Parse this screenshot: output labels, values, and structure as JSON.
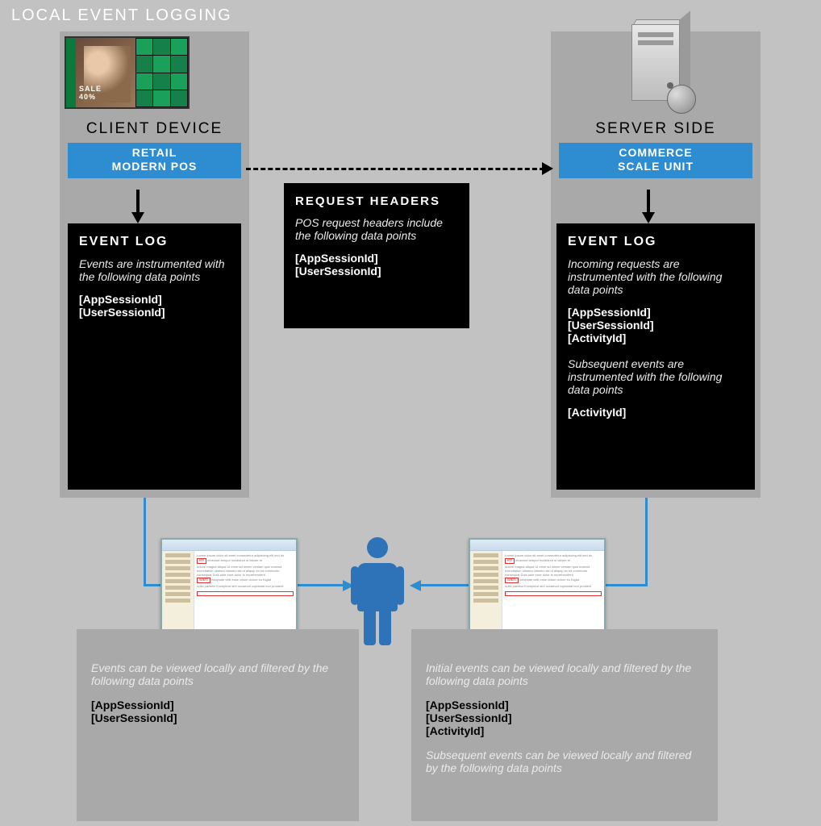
{
  "title": "LOCAL EVENT  LOGGING",
  "client": {
    "panel_title": "CLIENT DEVICE",
    "band_line1": "RETAIL",
    "band_line2": "MODERN POS",
    "tablet_sale_label": "SALE",
    "tablet_sale_sub": "40%",
    "eventlog_title": "EVENT LOG",
    "eventlog_desc": "Events are instrumented with the following data points",
    "eventlog_points": "[AppSessionId]\n[UserSessionId]"
  },
  "server": {
    "panel_title": "SERVER SIDE",
    "band_line1": "COMMERCE",
    "band_line2": "SCALE UNIT",
    "eventlog_title": "EVENT LOG",
    "eventlog_desc1": "Incoming requests are instrumented with the following data points",
    "eventlog_points1": "[AppSessionId]\n[UserSessionId]\n[ActivityId]",
    "eventlog_desc2": "Subsequent events are instrumented with the following data points",
    "eventlog_points2": "[ActivityId]"
  },
  "request_headers": {
    "title": "REQUEST HEADERS",
    "desc": "POS request headers include the following data points",
    "points": "[AppSessionId]\n[UserSessionId]"
  },
  "bottom_left": {
    "desc": "Events can be viewed locally and filtered by the following data points",
    "points": "[AppSessionId]\n[UserSessionId]"
  },
  "bottom_right": {
    "desc1": "Initial events can be viewed locally and filtered by the following data points",
    "points1": "[AppSessionId]\n[UserSessionId]\n[ActivityId]",
    "desc2": "Subsequent events can be viewed locally and filtered by the following data points"
  }
}
